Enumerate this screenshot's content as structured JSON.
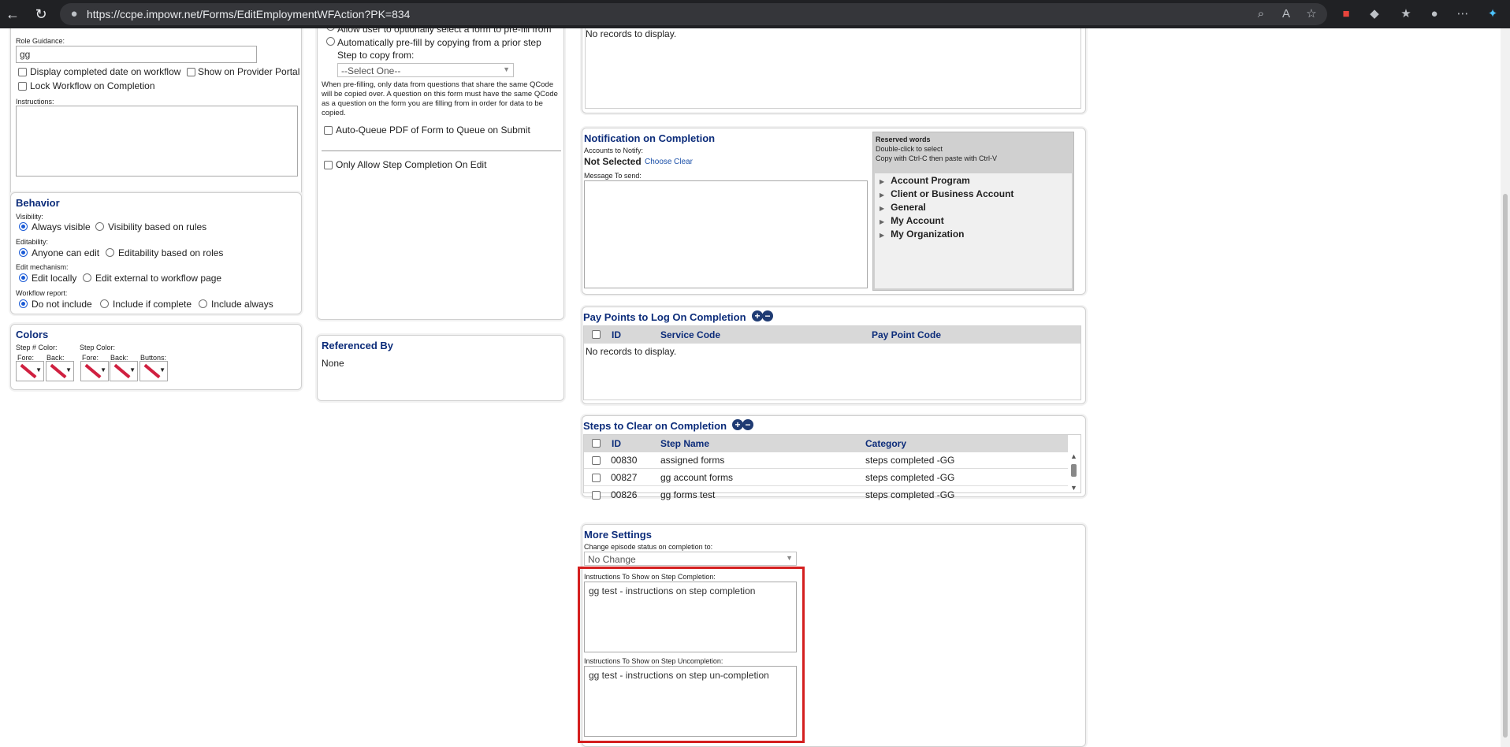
{
  "browser": {
    "url": "https://ccpe.impowr.net/Forms/EditEmploymentWFAction?PK=834"
  },
  "left": {
    "role_guidance_label": "Role Guidance:",
    "role_guidance_value": "gg",
    "display_completed": "Display completed date on workflow",
    "show_provider": "Show on Provider Portal",
    "lock_workflow": "Lock Workflow on Completion",
    "instructions_label": "Instructions:",
    "behavior": {
      "title": "Behavior",
      "visibility_label": "Visibility:",
      "always_visible": "Always visible",
      "visibility_rules": "Visibility based on rules",
      "editability_label": "Editability:",
      "anyone_edit": "Anyone can edit",
      "edit_roles": "Editability based on roles",
      "edit_mech_label": "Edit mechanism:",
      "edit_locally": "Edit locally",
      "edit_external": "Edit external to workflow page",
      "report_label": "Workflow report:",
      "do_not_include": "Do not include",
      "include_complete": "Include if complete",
      "include_always": "Include always"
    },
    "colors": {
      "title": "Colors",
      "step_num_label": "Step # Color:",
      "step_color_label": "Step Color:",
      "fore": "Fore:",
      "back": "Back:",
      "buttons": "Buttons:",
      "swatch_color": "#d02040"
    }
  },
  "middle": {
    "allow_optional": "Allow user to optionally select a form to pre-fill from",
    "auto_prefill": "Automatically pre-fill by copying from a prior step",
    "step_copy_label": "Step to copy from:",
    "select_one": "--Select One--",
    "prefill_note": "When pre-filling, only data from questions that share the same QCode will be copied over. A question on this form must have the same QCode as a question on the form you are filling from in order for data to be copied.",
    "auto_queue": "Auto-Queue PDF of Form to Queue on Submit",
    "only_allow": "Only Allow Step Completion On Edit",
    "referenced_by": {
      "title": "Referenced By",
      "value": "None"
    }
  },
  "right": {
    "top_grid_empty": "No records to display.",
    "notification": {
      "title": "Notification on Completion",
      "accounts_label": "Accounts to Notify:",
      "not_selected": "Not Selected",
      "choose": "Choose",
      "clear": "Clear",
      "message_label": "Message To send:",
      "reserved_title": "Reserved words",
      "reserved_hint1": "Double-click to select",
      "reserved_hint2": "Copy with Ctrl-C then paste with Ctrl-V",
      "tree": [
        "Account Program",
        "Client or Business Account",
        "General",
        "My Account",
        "My Organization"
      ]
    },
    "pay_points": {
      "title": "Pay Points to Log On Completion",
      "col_id": "ID",
      "col_service": "Service Code",
      "col_paypoint": "Pay Point Code",
      "empty": "No records to display."
    },
    "steps_clear": {
      "title": "Steps to Clear on Completion",
      "col_id": "ID",
      "col_name": "Step Name",
      "col_category": "Category",
      "rows": [
        {
          "id": "00830",
          "name": "assigned forms",
          "category": "steps completed -GG"
        },
        {
          "id": "00827",
          "name": "gg account forms",
          "category": "steps completed -GG"
        },
        {
          "id": "00826",
          "name": "gg forms test",
          "category": "steps completed -GG"
        }
      ]
    },
    "more_settings": {
      "title": "More Settings",
      "episode_label": "Change episode status on completion to:",
      "episode_value": "No Change",
      "completion_label": "Instructions To Show on Step Completion:",
      "completion_value": "gg test - instructions on step completion",
      "uncompletion_label": "Instructions To Show on Step Uncompletion:",
      "uncompletion_value": "gg test - instructions on step un-completion"
    }
  },
  "colors": {
    "heading": "#0c2c7a",
    "highlight": "#d41f1f",
    "radio": "#1a5ad6"
  }
}
